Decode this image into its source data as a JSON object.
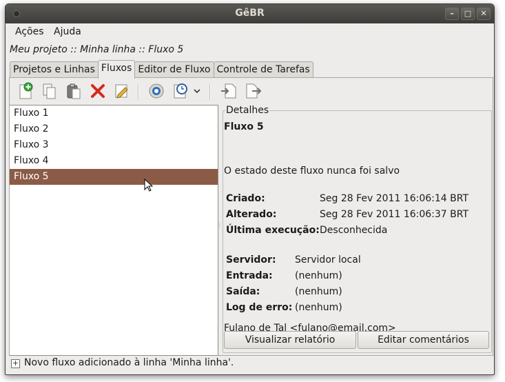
{
  "window": {
    "title": "GêBR"
  },
  "menu": [
    {
      "label": "Ações"
    },
    {
      "label": "Ajuda"
    }
  ],
  "breadcrumb": "Meu projeto :: Minha linha :: Fluxo 5",
  "tabs": [
    {
      "label": "Projetos e Linhas",
      "active": false
    },
    {
      "label": "Fluxos",
      "active": true
    },
    {
      "label": "Editor de Fluxo",
      "active": false
    },
    {
      "label": "Controle de Tarefas",
      "active": false
    }
  ],
  "toolbar": {
    "icons": [
      "new-flow-icon",
      "copy-icon",
      "paste-icon",
      "delete-icon",
      "edit-icon",
      "run-icon",
      "schedule-icon",
      "chevron-down-icon",
      "import-icon",
      "export-icon"
    ]
  },
  "flows": [
    {
      "label": "Fluxo 1",
      "selected": false
    },
    {
      "label": "Fluxo 2",
      "selected": false
    },
    {
      "label": "Fluxo 3",
      "selected": false
    },
    {
      "label": "Fluxo 4",
      "selected": false
    },
    {
      "label": "Fluxo 5",
      "selected": true
    }
  ],
  "details": {
    "legend": "Detalhes",
    "name": "Fluxo 5",
    "state": "O estado deste fluxo nunca foi salvo",
    "created_label": "Criado:",
    "created_value": "Seg 28 Fev 2011 16:06:14 BRT",
    "modified_label": "Alterado:",
    "modified_value": "Seg 28 Fev 2011 16:06:37 BRT",
    "last_run_label": "Última execução:",
    "last_run_value": "Desconhecida",
    "server_label": "Servidor:",
    "server_value": "Servidor local",
    "input_label": "Entrada:",
    "input_value": "(nenhum)",
    "output_label": "Saída:",
    "output_value": "(nenhum)",
    "log_label": "Log de erro:",
    "log_value": "(nenhum)",
    "author": "Fulano de Tal <fulano@email.com>",
    "report_button": "Visualizar relatório",
    "comments_button": "Editar comentários"
  },
  "status": {
    "text": "Novo fluxo adicionado à linha 'Minha linha'."
  },
  "colors": {
    "selection": "#8c5b46",
    "titlebar": "#3d3c38",
    "window_bg": "#edeceb"
  }
}
